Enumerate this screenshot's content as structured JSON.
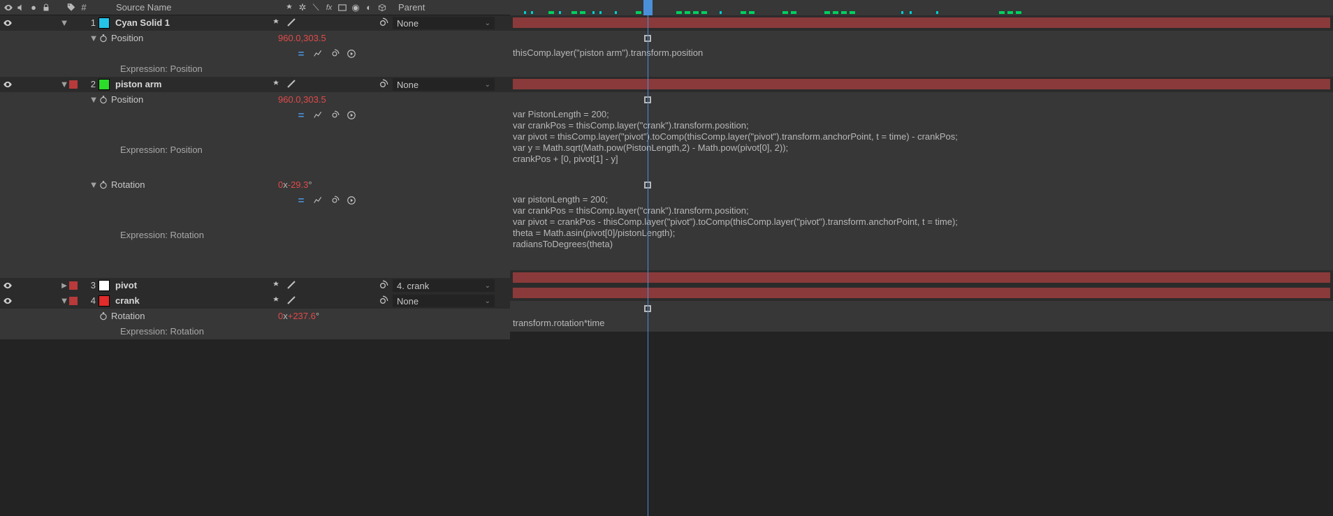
{
  "header": {
    "source_col": "Source Name",
    "parent_col": "Parent",
    "num_col": "#"
  },
  "colors": {
    "label_red": "#b83a3a",
    "cyan": "#25c3e8",
    "green": "#2bdc2b",
    "white": "#ffffff",
    "red": "#e22b2b"
  },
  "parent_options": {
    "none": "None",
    "crank": "4. crank"
  },
  "layers": [
    {
      "num": "1",
      "name": "Cyan Solid 1",
      "color_key": "cyan",
      "label_key": "label_red",
      "twirl": "▼",
      "parent_key": "none",
      "props": [
        {
          "twirl": "▼",
          "name": "Position",
          "value": "960.0,303.5",
          "expr_label": "Expression: Position",
          "expression": "thisComp.layer(\"piston arm\").transform.position"
        }
      ]
    },
    {
      "num": "2",
      "name": "piston arm",
      "color_key": "green",
      "label_key": "label_red",
      "twirl": "▼",
      "parent_key": "none",
      "props": [
        {
          "twirl": "▼",
          "name": "Position",
          "value": "960.0,303.5",
          "expr_label": "Expression: Position",
          "expression": "var PistonLength = 200;\nvar crankPos = thisComp.layer(\"crank\").transform.position;\nvar pivot = thisComp.layer(\"pivot\").toComp(thisComp.layer(\"pivot\").transform.anchorPoint, t = time) - crankPos;\nvar y = Math.sqrt(Math.pow(PistonLength,2) - Math.pow(pivot[0], 2));\ncrankPos + [0, pivot[1] - y]"
        },
        {
          "twirl": "▼",
          "name": "Rotation",
          "value_pre": "0",
          "value_unit": "x",
          "value_num": "-29.3",
          "value_suffix": "°",
          "expr_label": "Expression: Rotation",
          "expression": "var pistonLength = 200;\nvar crankPos = thisComp.layer(\"crank\").transform.position;\nvar pivot = crankPos - thisComp.layer(\"pivot\").toComp(thisComp.layer(\"pivot\").transform.anchorPoint, t = time);\ntheta = Math.asin(pivot[0]/pistonLength);\nradiansToDegrees(theta)"
        }
      ]
    },
    {
      "num": "3",
      "name": "pivot",
      "color_key": "white",
      "label_key": "label_red",
      "twirl": "►",
      "parent_key": "crank",
      "props": []
    },
    {
      "num": "4",
      "name": "crank",
      "color_key": "red",
      "label_key": "label_red",
      "twirl": "▼",
      "parent_key": "none",
      "props": [
        {
          "twirl": "",
          "name": "Rotation",
          "value_pre": "0",
          "value_unit": "x",
          "value_num": "+237.6",
          "value_suffix": "°",
          "expr_label": "Expression: Rotation",
          "expression": "transform.rotation*time"
        }
      ]
    }
  ]
}
